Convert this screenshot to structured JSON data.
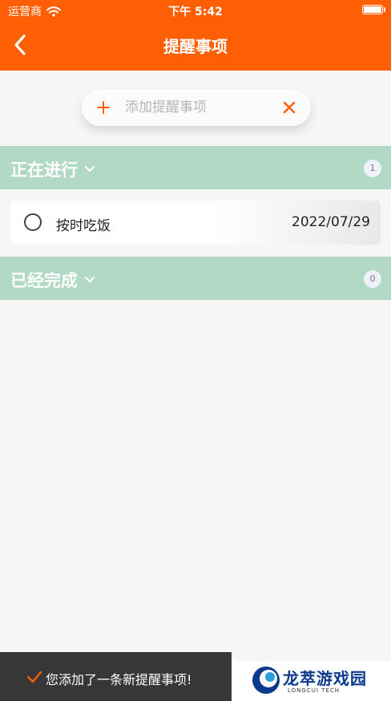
{
  "status_bar": {
    "carrier": "运营商",
    "time": "下午 5:42"
  },
  "nav": {
    "title": "提醒事项"
  },
  "add_bar": {
    "placeholder": "添加提醒事项",
    "value": ""
  },
  "sections": [
    {
      "title": "正在进行",
      "count": "1"
    },
    {
      "title": "已经完成",
      "count": "0"
    }
  ],
  "tasks": [
    {
      "name": "按时吃饭",
      "date": "2022/07/29"
    }
  ],
  "toast": {
    "message": "您添加了一条新提醒事项!"
  },
  "watermark": {
    "name": "龙萃游戏园",
    "sub": "LONGCUI TECH"
  },
  "colors": {
    "accent": "#fe5f05",
    "section_bg": "#b1d9c5",
    "toast_bg": "#373737",
    "watermark_blue": "#0b3a8c"
  }
}
